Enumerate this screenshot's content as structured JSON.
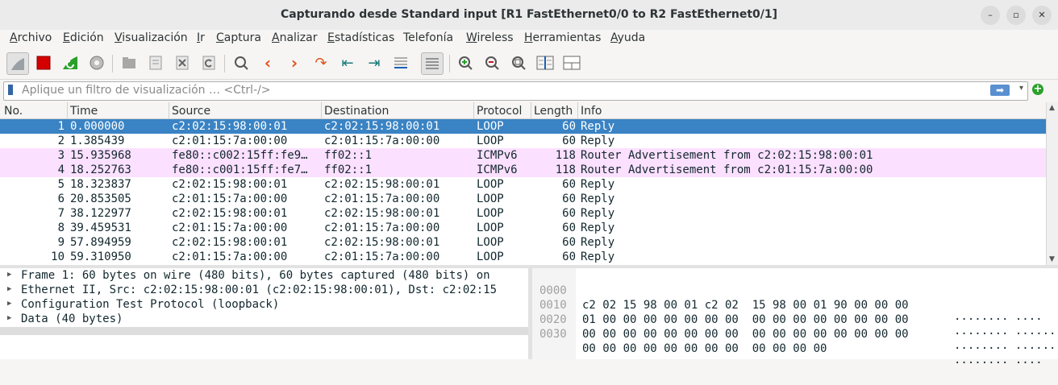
{
  "window": {
    "title": "Capturando desde Standard input [R1 FastEthernet0/0 to R2 FastEthernet0/1]",
    "minimize": "–",
    "maximize": "▫",
    "close": "✕"
  },
  "menu": [
    {
      "u": "A",
      "rest": "rchivo"
    },
    {
      "u": "E",
      "rest": "dición"
    },
    {
      "u": "V",
      "rest": "isualización"
    },
    {
      "u": "I",
      "rest": "r"
    },
    {
      "u": "C",
      "rest": "aptura"
    },
    {
      "u": "A",
      "rest": "nalizar"
    },
    {
      "u": "E",
      "rest": "stadísticas"
    },
    {
      "u": "",
      "rest": "Telefonía"
    },
    {
      "u": "W",
      "rest": "ireless"
    },
    {
      "u": "H",
      "rest": "erramientas"
    },
    {
      "u": "A",
      "rest": "yuda"
    }
  ],
  "toolbar": {
    "icons": [
      "shark-fin-icon",
      "stop-icon",
      "restart-capture-icon",
      "capture-options-icon",
      "open-file-icon",
      "save-file-icon",
      "close-file-icon",
      "reload-icon",
      "find-packet-icon",
      "previous-packet-icon",
      "next-packet-icon",
      "go-to-packet-icon",
      "first-packet-icon",
      "last-packet-icon",
      "autoscroll-icon",
      "colorize-icon",
      "zoom-in-icon",
      "zoom-out-icon",
      "normal-size-icon",
      "resize-columns-icon",
      "layout-icon"
    ]
  },
  "filter": {
    "placeholder": "Aplique un filtro de visualización … <Ctrl-/>",
    "apply_symbol": "➡",
    "dropdown_symbol": "▾",
    "add_symbol": "+"
  },
  "columns": {
    "no": "No.",
    "time": "Time",
    "source": "Source",
    "destination": "Destination",
    "protocol": "Protocol",
    "length": "Length",
    "info": "Info"
  },
  "packets": [
    {
      "no": "1",
      "time": "0.000000",
      "src": "c2:02:15:98:00:01",
      "dst": "c2:02:15:98:00:01",
      "proto": "LOOP",
      "len": "60",
      "info": "Reply",
      "style": "sel"
    },
    {
      "no": "2",
      "time": "1.385439",
      "src": "c2:01:15:7a:00:00",
      "dst": "c2:01:15:7a:00:00",
      "proto": "LOOP",
      "len": "60",
      "info": "Reply",
      "style": ""
    },
    {
      "no": "3",
      "time": "15.935968",
      "src": "fe80::c002:15ff:fe9…",
      "dst": "ff02::1",
      "proto": "ICMPv6",
      "len": "118",
      "info": "Router Advertisement from c2:02:15:98:00:01",
      "style": "icmp"
    },
    {
      "no": "4",
      "time": "18.252763",
      "src": "fe80::c001:15ff:fe7…",
      "dst": "ff02::1",
      "proto": "ICMPv6",
      "len": "118",
      "info": "Router Advertisement from c2:01:15:7a:00:00",
      "style": "icmp"
    },
    {
      "no": "5",
      "time": "18.323837",
      "src": "c2:02:15:98:00:01",
      "dst": "c2:02:15:98:00:01",
      "proto": "LOOP",
      "len": "60",
      "info": "Reply",
      "style": ""
    },
    {
      "no": "6",
      "time": "20.853505",
      "src": "c2:01:15:7a:00:00",
      "dst": "c2:01:15:7a:00:00",
      "proto": "LOOP",
      "len": "60",
      "info": "Reply",
      "style": ""
    },
    {
      "no": "7",
      "time": "38.122977",
      "src": "c2:02:15:98:00:01",
      "dst": "c2:02:15:98:00:01",
      "proto": "LOOP",
      "len": "60",
      "info": "Reply",
      "style": ""
    },
    {
      "no": "8",
      "time": "39.459531",
      "src": "c2:01:15:7a:00:00",
      "dst": "c2:01:15:7a:00:00",
      "proto": "LOOP",
      "len": "60",
      "info": "Reply",
      "style": ""
    },
    {
      "no": "9",
      "time": "57.894959",
      "src": "c2:02:15:98:00:01",
      "dst": "c2:02:15:98:00:01",
      "proto": "LOOP",
      "len": "60",
      "info": "Reply",
      "style": ""
    },
    {
      "no": "10",
      "time": "59.310950",
      "src": "c2:01:15:7a:00:00",
      "dst": "c2:01:15:7a:00:00",
      "proto": "LOOP",
      "len": "60",
      "info": "Reply",
      "style": ""
    }
  ],
  "details": [
    "Frame 1: 60 bytes on wire (480 bits), 60 bytes captured (480 bits) on",
    "Ethernet II, Src: c2:02:15:98:00:01 (c2:02:15:98:00:01), Dst: c2:02:15",
    "Configuration Test Protocol (loopback)",
    "Data (40 bytes)"
  ],
  "bytes": [
    {
      "offset": "0000",
      "hex": "c2 02 15 98 00 01 c2 02  15 98 00 01 90 00 00 00",
      "ascii": "········ ····"
    },
    {
      "offset": "0010",
      "hex": "01 00 00 00 00 00 00 00  00 00 00 00 00 00 00 00",
      "ascii": "········ ········"
    },
    {
      "offset": "0020",
      "hex": "00 00 00 00 00 00 00 00  00 00 00 00 00 00 00 00",
      "ascii": "········ ········"
    },
    {
      "offset": "0030",
      "hex": "00 00 00 00 00 00 00 00  00 00 00 00",
      "ascii": "········ ····"
    }
  ],
  "colors": {
    "selected_row": "#3a83c4",
    "icmpv6_row": "#fce0ff",
    "stop_red": "#d40000",
    "restart_green": "#2aa02a"
  }
}
